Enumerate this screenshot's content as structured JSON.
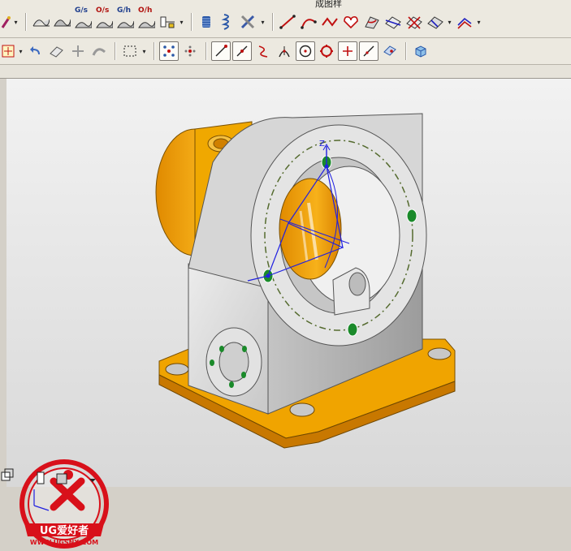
{
  "window": {
    "title_fragment": "成图样"
  },
  "toolbar_top": {
    "label_gs": "G/s",
    "label_os": "O/s",
    "label_gh": "G/h",
    "label_oh": "O/h"
  },
  "watermark": {
    "brand_text": "UG爱好者",
    "url_text": "WWW.UGSNX.COM"
  },
  "triad": {
    "z_label": "Z"
  },
  "colors": {
    "toolbar_bg": "#ece9e0",
    "viewport_top": "#f2f2f2",
    "viewport_bottom": "#d8d8d8",
    "part_body": "#dedede",
    "part_accent": "#f0a000",
    "selection_blue": "#2020e0",
    "watermark_red": "#d8101a"
  }
}
